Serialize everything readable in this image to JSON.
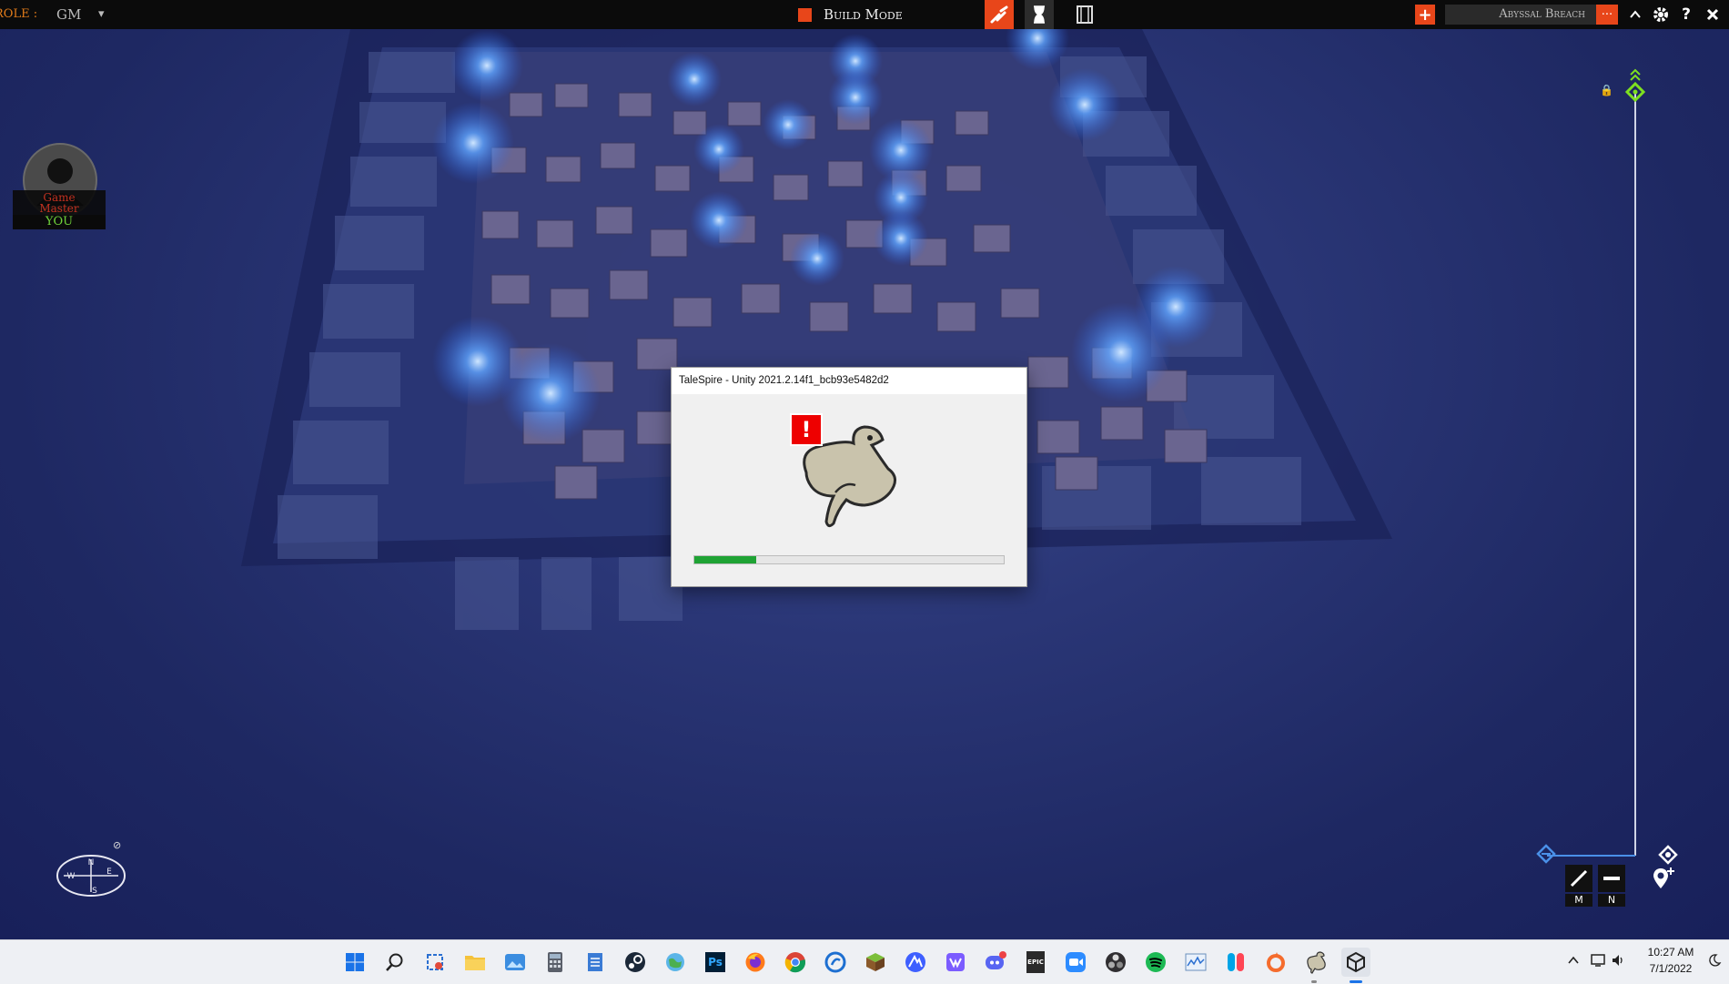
{
  "topbar": {
    "role_label": "ROLE :",
    "role_value": "GM",
    "role_dropdown_arrow": "▾",
    "mode_label": "Build Mode",
    "campaign_name": "Abyssal Breach",
    "campaign_menu": "...",
    "icons": [
      "build-mode-square-icon",
      "paint-tool-icon",
      "hourglass-icon",
      "film-icon",
      "add-board-icon",
      "chevron-up-icon",
      "gear-icon",
      "help-icon",
      "close-icon"
    ]
  },
  "player": {
    "line1": "Game",
    "line2": "Master",
    "you_label": "YOU"
  },
  "dialog": {
    "title": "TaleSpire - Unity 2021.2.14f1_bcb93e5482d2",
    "progress": 0.2
  },
  "right_panel": {
    "key_m": "M",
    "key_n": "N"
  },
  "compass": {
    "n": "N",
    "s": "S",
    "e": "E",
    "w": "W"
  },
  "taskbar": {
    "time": "10:27 AM",
    "date": "7/1/2022",
    "apps": [
      "windows-start-icon",
      "search-icon",
      "snipping-tool-icon",
      "file-explorer-icon",
      "photos-icon",
      "calculator-icon",
      "notepad-icon",
      "steam-icon",
      "network-globe-icon",
      "photoshop-icon",
      "firefox-icon",
      "chrome-icon",
      "edge-dev-icon",
      "minecraft-icon",
      "nordvpn-icon",
      "sticky-notes-icon",
      "discord-icon",
      "epic-games-icon",
      "zoom-icon",
      "obs-icon",
      "spotify-icon",
      "task-manager-icon",
      "joycon-icon",
      "origin-icon",
      "talespire-icon",
      "unity-icon"
    ],
    "photoshop_label": "Ps",
    "epic_label": "EPIC"
  },
  "colors": {
    "accent_orange": "#e8461a",
    "progress_green": "#1fa334",
    "gm_red": "#c33120",
    "you_green": "#6fd23a",
    "marker_green": "#7ee020",
    "axis_blue": "#4a90e8"
  }
}
